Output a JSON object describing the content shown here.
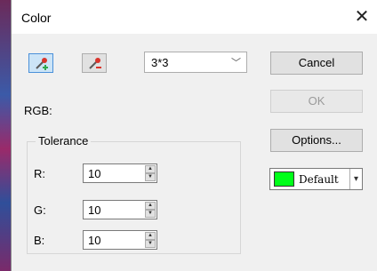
{
  "dialog": {
    "title": "Color",
    "close_glyph": "✕"
  },
  "toolbar": {
    "add_picker_icon": "eyedropper-add-icon",
    "remove_picker_icon": "eyedropper-remove-icon",
    "sample_size": "3*3",
    "dropdown_glyph": "﹀"
  },
  "buttons": {
    "cancel": "Cancel",
    "ok": "OK",
    "options": "Options..."
  },
  "rgb": {
    "label": "RGB:"
  },
  "tolerance": {
    "legend": "Tolerance",
    "r_label": "R:",
    "r_value": "10",
    "g_label": "G:",
    "g_value": "10",
    "b_label": "B:",
    "b_value": "10",
    "spin_up": "▲",
    "spin_down": "▼"
  },
  "color_select": {
    "name": "Default",
    "swatch_color": "#00ff1a",
    "arrow": "▾"
  },
  "colors": {
    "accent": "#4a90d9",
    "swatch": "#00ff1a",
    "dropper_red": "#d9342b",
    "dropper_green": "#2fa84f"
  }
}
